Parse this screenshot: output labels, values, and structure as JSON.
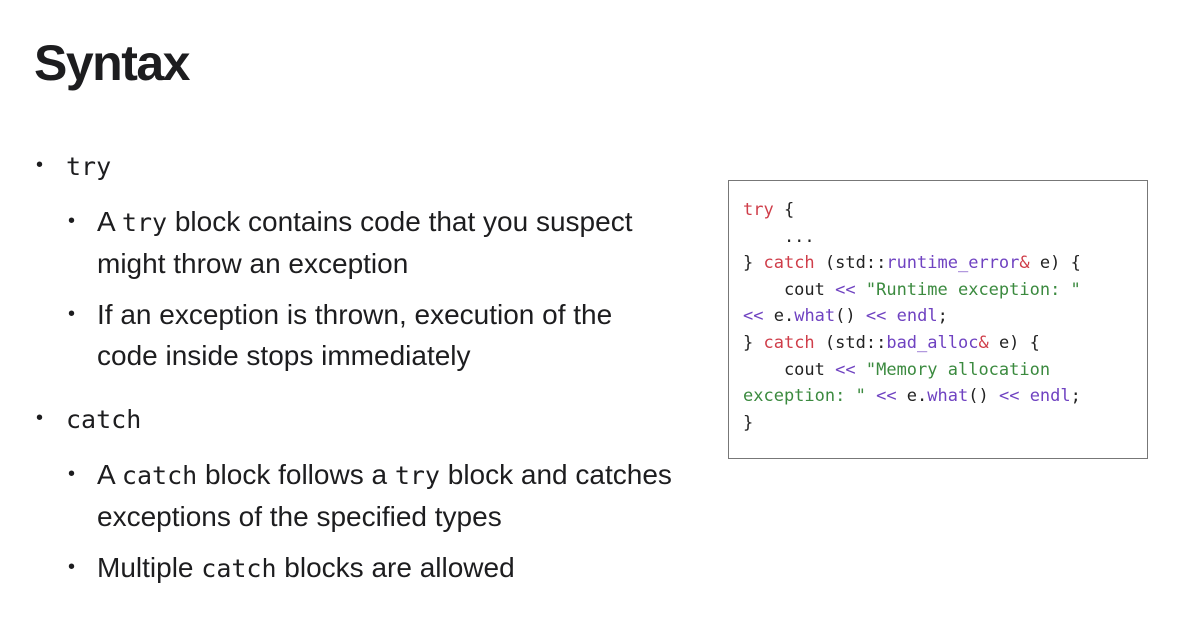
{
  "title": "Syntax",
  "bullets": [
    {
      "term": "try",
      "items": [
        [
          {
            "t": "A "
          },
          {
            "m": "try"
          },
          {
            "t": " block contains code that you suspect might throw an exception"
          }
        ],
        [
          {
            "t": "If an exception is thrown, execution of the code inside stops immediately"
          }
        ]
      ]
    },
    {
      "term": "catch",
      "items": [
        [
          {
            "t": "A "
          },
          {
            "m": "catch"
          },
          {
            "t": " block follows a "
          },
          {
            "m": "try"
          },
          {
            "t": " block and catches exceptions of the specified types"
          }
        ],
        [
          {
            "t": "Multiple "
          },
          {
            "m": "catch"
          },
          {
            "t": " blocks are allowed"
          }
        ]
      ]
    }
  ],
  "colors": {
    "keyword": "#cf3e4a",
    "type": "#6f42c1",
    "string": "#3b8a3f",
    "text": "#222222"
  },
  "code_lines": [
    [
      [
        "kw",
        "try"
      ],
      [
        "pl",
        " {"
      ]
    ],
    [
      [
        "pl",
        "    ..."
      ]
    ],
    [
      [
        "pl",
        "} "
      ],
      [
        "kw",
        "catch"
      ],
      [
        "pl",
        " (std::"
      ],
      [
        "ty",
        "runtime_error"
      ],
      [
        "kw",
        "&"
      ],
      [
        "pl",
        " e) {"
      ]
    ],
    [
      [
        "pl",
        "    cout "
      ],
      [
        "ty",
        "<<"
      ],
      [
        "pl",
        " "
      ],
      [
        "st",
        "\"Runtime exception: \""
      ]
    ],
    [
      [
        "ty",
        "<<"
      ],
      [
        "pl",
        " e."
      ],
      [
        "ty",
        "what"
      ],
      [
        "pl",
        "() "
      ],
      [
        "ty",
        "<<"
      ],
      [
        "pl",
        " "
      ],
      [
        "ty",
        "endl"
      ],
      [
        "pl",
        ";"
      ]
    ],
    [
      [
        "pl",
        "} "
      ],
      [
        "kw",
        "catch"
      ],
      [
        "pl",
        " (std::"
      ],
      [
        "ty",
        "bad_alloc"
      ],
      [
        "kw",
        "&"
      ],
      [
        "pl",
        " e) {"
      ]
    ],
    [
      [
        "pl",
        "    cout "
      ],
      [
        "ty",
        "<<"
      ],
      [
        "pl",
        " "
      ],
      [
        "st",
        "\"Memory allocation"
      ]
    ],
    [
      [
        "st",
        "exception: \""
      ],
      [
        "pl",
        " "
      ],
      [
        "ty",
        "<<"
      ],
      [
        "pl",
        " e."
      ],
      [
        "ty",
        "what"
      ],
      [
        "pl",
        "() "
      ],
      [
        "ty",
        "<<"
      ],
      [
        "pl",
        " "
      ],
      [
        "ty",
        "endl"
      ],
      [
        "pl",
        ";"
      ]
    ],
    [
      [
        "pl",
        "}"
      ]
    ]
  ]
}
